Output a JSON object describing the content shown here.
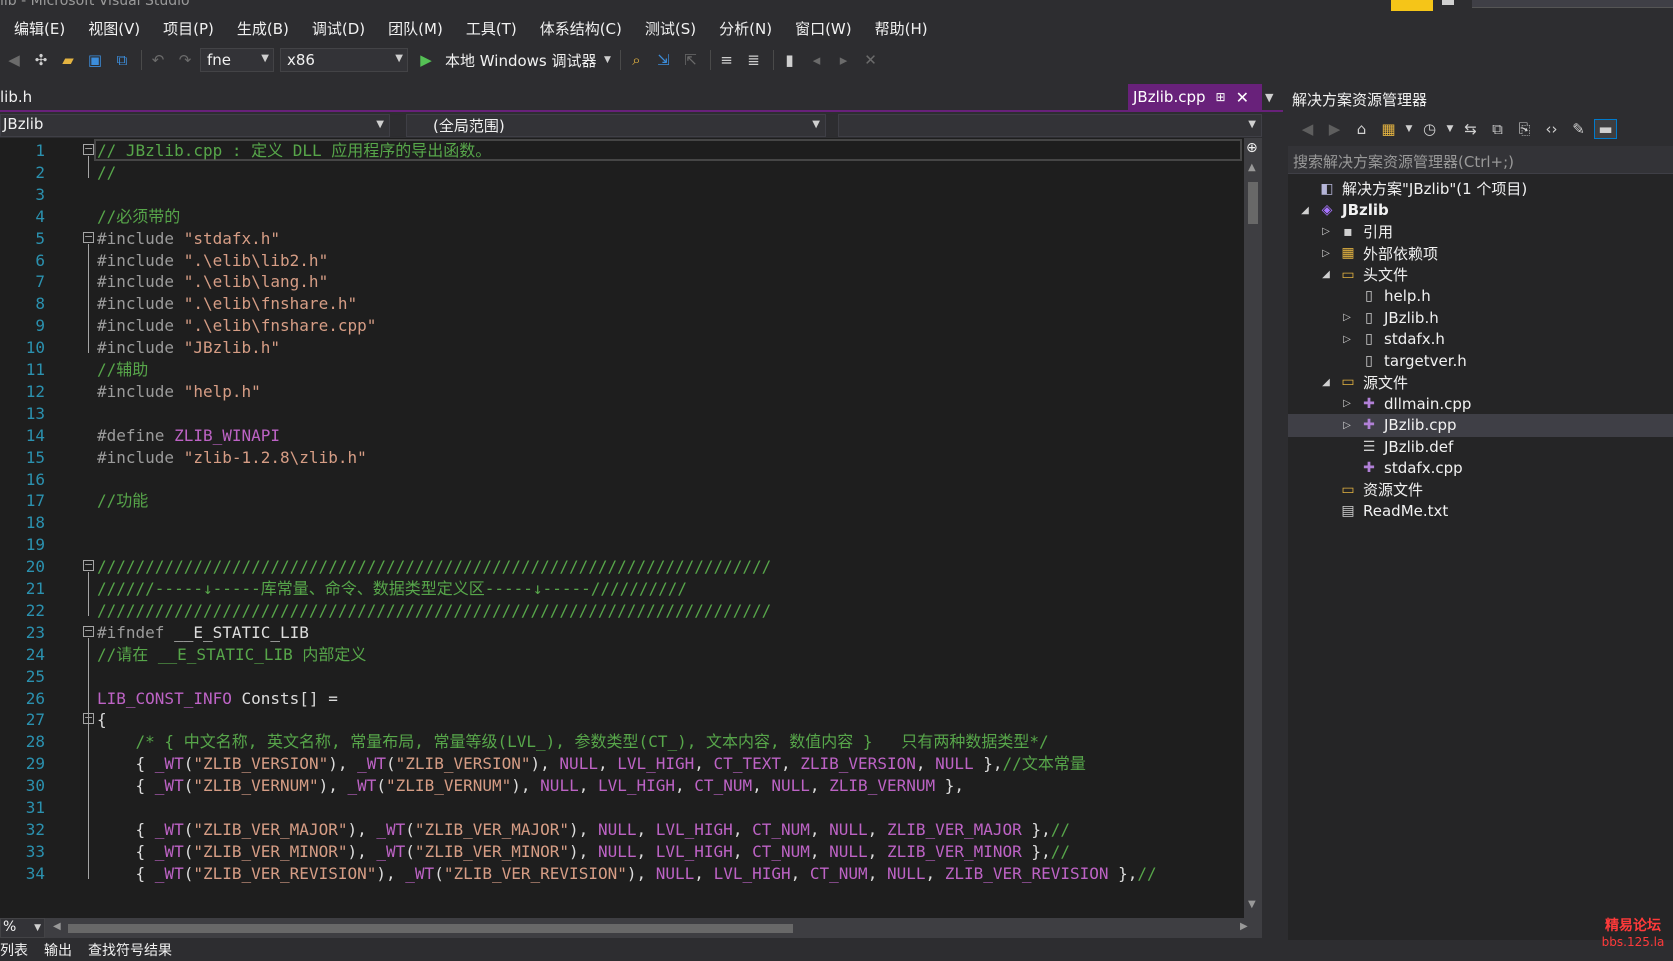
{
  "window": {
    "title": "lib - Microsoft Visual Studio"
  },
  "menu": [
    "编辑(E)",
    "视图(V)",
    "项目(P)",
    "生成(B)",
    "调试(D)",
    "团队(M)",
    "工具(T)",
    "体系结构(C)",
    "测试(S)",
    "分析(N)",
    "窗口(W)",
    "帮助(H)"
  ],
  "toolbar": {
    "config": "fne",
    "platform": "x86",
    "run_label": "本地 Windows 调试器",
    "icons": [
      "back-icon",
      "new-project-icon",
      "open-icon",
      "save-icon",
      "save-all-icon",
      "undo-icon",
      "redo-icon",
      "run-icon",
      "find-icon",
      "step-icon",
      "comment-icon",
      "bookmark-icon"
    ]
  },
  "tabs": {
    "left_tab": "lib.h",
    "active_tab": "JBzlib.cpp"
  },
  "navbar": {
    "project": "JBzlib",
    "scope": "(全局范围)",
    "member": ""
  },
  "editor": {
    "lines": [
      {
        "n": "1",
        "segs": [
          [
            "c-cmt",
            "// JBzlib.cpp : 定义 DLL 应用程序的导出函数。"
          ]
        ]
      },
      {
        "n": "2",
        "segs": [
          [
            "c-cmt",
            "//"
          ]
        ]
      },
      {
        "n": "3",
        "segs": []
      },
      {
        "n": "4",
        "segs": [
          [
            "c-cmt",
            "//必须带的"
          ]
        ]
      },
      {
        "n": "5",
        "segs": [
          [
            "c-pp",
            "#include "
          ],
          [
            "c-str",
            "\"stdafx.h\""
          ]
        ]
      },
      {
        "n": "6",
        "segs": [
          [
            "c-pp",
            "#include "
          ],
          [
            "c-str",
            "\".\\elib\\lib2.h\""
          ]
        ]
      },
      {
        "n": "7",
        "segs": [
          [
            "c-pp",
            "#include "
          ],
          [
            "c-str",
            "\".\\elib\\lang.h\""
          ]
        ]
      },
      {
        "n": "8",
        "segs": [
          [
            "c-pp",
            "#include "
          ],
          [
            "c-str",
            "\".\\elib\\fnshare.h\""
          ]
        ]
      },
      {
        "n": "9",
        "segs": [
          [
            "c-pp",
            "#include "
          ],
          [
            "c-str",
            "\".\\elib\\fnshare.cpp\""
          ]
        ]
      },
      {
        "n": "10",
        "segs": [
          [
            "c-pp",
            "#include "
          ],
          [
            "c-str",
            "\"JBzlib.h\""
          ]
        ]
      },
      {
        "n": "11",
        "segs": [
          [
            "c-cmt",
            "//辅助"
          ]
        ]
      },
      {
        "n": "12",
        "segs": [
          [
            "c-pp",
            "#include "
          ],
          [
            "c-str",
            "\"help.h\""
          ]
        ]
      },
      {
        "n": "13",
        "segs": []
      },
      {
        "n": "14",
        "segs": [
          [
            "c-pp",
            "#define "
          ],
          [
            "c-mac",
            "ZLIB_WINAPI"
          ]
        ]
      },
      {
        "n": "15",
        "segs": [
          [
            "c-pp",
            "#include "
          ],
          [
            "c-str",
            "\"zlib-1.2.8\\zlib.h\""
          ]
        ]
      },
      {
        "n": "16",
        "segs": []
      },
      {
        "n": "17",
        "segs": [
          [
            "c-cmt",
            "//功能"
          ]
        ]
      },
      {
        "n": "18",
        "segs": []
      },
      {
        "n": "19",
        "segs": []
      },
      {
        "n": "20",
        "segs": [
          [
            "c-cmt",
            "//////////////////////////////////////////////////////////////////////"
          ]
        ]
      },
      {
        "n": "21",
        "segs": [
          [
            "c-cmt",
            "//////-----↓-----库常量、命令、数据类型定义区-----↓-----//////////"
          ]
        ]
      },
      {
        "n": "22",
        "segs": [
          [
            "c-cmt",
            "//////////////////////////////////////////////////////////////////////"
          ]
        ]
      },
      {
        "n": "23",
        "segs": [
          [
            "c-pp",
            "#ifndef "
          ],
          [
            "c-id",
            "__E_STATIC_LIB"
          ]
        ]
      },
      {
        "n": "24",
        "segs": [
          [
            "c-cmt",
            "//请在 __E_STATIC_LIB 内部定义"
          ]
        ]
      },
      {
        "n": "25",
        "segs": []
      },
      {
        "n": "26",
        "segs": [
          [
            "c-mac",
            "LIB_CONST_INFO"
          ],
          [
            "c-id",
            " Consts[] ="
          ]
        ]
      },
      {
        "n": "27",
        "segs": [
          [
            "c-id",
            "{"
          ]
        ]
      },
      {
        "n": "28",
        "segs": [
          [
            "c-id",
            "    "
          ],
          [
            "c-cmt",
            "/* { 中文名称, 英文名称, 常量布局, 常量等级(LVL_), 参数类型(CT_), 文本内容, 数值内容 }   只有两种数据类型*/"
          ]
        ]
      },
      {
        "n": "29",
        "segs": [
          [
            "c-id",
            "    { "
          ],
          [
            "c-mac",
            "_WT"
          ],
          [
            "c-id",
            "("
          ],
          [
            "c-str",
            "\"ZLIB_VERSION\""
          ],
          [
            "c-id",
            "), "
          ],
          [
            "c-mac",
            "_WT"
          ],
          [
            "c-id",
            "("
          ],
          [
            "c-str",
            "\"ZLIB_VERSION\""
          ],
          [
            "c-id",
            "), "
          ],
          [
            "c-mac",
            "NULL"
          ],
          [
            "c-id",
            ", "
          ],
          [
            "c-mac",
            "LVL_HIGH"
          ],
          [
            "c-id",
            ", "
          ],
          [
            "c-mac",
            "CT_TEXT"
          ],
          [
            "c-id",
            ", "
          ],
          [
            "c-mac",
            "ZLIB_VERSION"
          ],
          [
            "c-id",
            ", "
          ],
          [
            "c-mac",
            "NULL"
          ],
          [
            "c-id",
            " },"
          ],
          [
            "c-cmt",
            "//文本常量"
          ]
        ]
      },
      {
        "n": "30",
        "segs": [
          [
            "c-id",
            "    { "
          ],
          [
            "c-mac",
            "_WT"
          ],
          [
            "c-id",
            "("
          ],
          [
            "c-str",
            "\"ZLIB_VERNUM\""
          ],
          [
            "c-id",
            "), "
          ],
          [
            "c-mac",
            "_WT"
          ],
          [
            "c-id",
            "("
          ],
          [
            "c-str",
            "\"ZLIB_VERNUM\""
          ],
          [
            "c-id",
            "), "
          ],
          [
            "c-mac",
            "NULL"
          ],
          [
            "c-id",
            ", "
          ],
          [
            "c-mac",
            "LVL_HIGH"
          ],
          [
            "c-id",
            ", "
          ],
          [
            "c-mac",
            "CT_NUM"
          ],
          [
            "c-id",
            ", "
          ],
          [
            "c-mac",
            "NULL"
          ],
          [
            "c-id",
            ", "
          ],
          [
            "c-mac",
            "ZLIB_VERNUM"
          ],
          [
            "c-id",
            " },"
          ]
        ]
      },
      {
        "n": "31",
        "segs": []
      },
      {
        "n": "32",
        "segs": [
          [
            "c-id",
            "    { "
          ],
          [
            "c-mac",
            "_WT"
          ],
          [
            "c-id",
            "("
          ],
          [
            "c-str",
            "\"ZLIB_VER_MAJOR\""
          ],
          [
            "c-id",
            "), "
          ],
          [
            "c-mac",
            "_WT"
          ],
          [
            "c-id",
            "("
          ],
          [
            "c-str",
            "\"ZLIB_VER_MAJOR\""
          ],
          [
            "c-id",
            "), "
          ],
          [
            "c-mac",
            "NULL"
          ],
          [
            "c-id",
            ", "
          ],
          [
            "c-mac",
            "LVL_HIGH"
          ],
          [
            "c-id",
            ", "
          ],
          [
            "c-mac",
            "CT_NUM"
          ],
          [
            "c-id",
            ", "
          ],
          [
            "c-mac",
            "NULL"
          ],
          [
            "c-id",
            ", "
          ],
          [
            "c-mac",
            "ZLIB_VER_MAJOR"
          ],
          [
            "c-id",
            " },"
          ],
          [
            "c-cmt",
            "//"
          ]
        ]
      },
      {
        "n": "33",
        "segs": [
          [
            "c-id",
            "    { "
          ],
          [
            "c-mac",
            "_WT"
          ],
          [
            "c-id",
            "("
          ],
          [
            "c-str",
            "\"ZLIB_VER_MINOR\""
          ],
          [
            "c-id",
            "), "
          ],
          [
            "c-mac",
            "_WT"
          ],
          [
            "c-id",
            "("
          ],
          [
            "c-str",
            "\"ZLIB_VER_MINOR\""
          ],
          [
            "c-id",
            "), "
          ],
          [
            "c-mac",
            "NULL"
          ],
          [
            "c-id",
            ", "
          ],
          [
            "c-mac",
            "LVL_HIGH"
          ],
          [
            "c-id",
            ", "
          ],
          [
            "c-mac",
            "CT_NUM"
          ],
          [
            "c-id",
            ", "
          ],
          [
            "c-mac",
            "NULL"
          ],
          [
            "c-id",
            ", "
          ],
          [
            "c-mac",
            "ZLIB_VER_MINOR"
          ],
          [
            "c-id",
            " },"
          ],
          [
            "c-cmt",
            "//"
          ]
        ]
      },
      {
        "n": "34",
        "segs": [
          [
            "c-id",
            "    { "
          ],
          [
            "c-mac",
            "_WT"
          ],
          [
            "c-id",
            "("
          ],
          [
            "c-str",
            "\"ZLIB_VER_REVISION\""
          ],
          [
            "c-id",
            "), "
          ],
          [
            "c-mac",
            "_WT"
          ],
          [
            "c-id",
            "("
          ],
          [
            "c-str",
            "\"ZLIB_VER_REVISION\""
          ],
          [
            "c-id",
            "), "
          ],
          [
            "c-mac",
            "NULL"
          ],
          [
            "c-id",
            ", "
          ],
          [
            "c-mac",
            "LVL_HIGH"
          ],
          [
            "c-id",
            ", "
          ],
          [
            "c-mac",
            "CT_NUM"
          ],
          [
            "c-id",
            ", "
          ],
          [
            "c-mac",
            "NULL"
          ],
          [
            "c-id",
            ", "
          ],
          [
            "c-mac",
            "ZLIB_VER_REVISION"
          ],
          [
            "c-id",
            " },"
          ],
          [
            "c-cmt",
            "//"
          ]
        ]
      }
    ],
    "fold_lines": [
      "1",
      "5",
      "20",
      "23",
      "27"
    ]
  },
  "zoom": "%",
  "bottom_tabs": [
    "列表",
    "输出",
    "查找符号结果"
  ],
  "solution_explorer": {
    "title": "解决方案资源管理器",
    "search_placeholder": "搜索解决方案资源管理器(Ctrl+;)",
    "tree": [
      {
        "label": "解决方案\"JBzlib\"(1 个项目)",
        "level": 0,
        "exp": "",
        "icon": "solution-icon",
        "cls": "ico-sln",
        "glyph": "◧"
      },
      {
        "label": "JBzlib",
        "level": 0,
        "exp": "◢",
        "icon": "project-icon",
        "cls": "ico-proj",
        "glyph": "◈",
        "bold": true
      },
      {
        "label": "引用",
        "level": 1,
        "exp": "▷",
        "icon": "references-icon",
        "cls": "ico-ref",
        "glyph": "▪"
      },
      {
        "label": "外部依赖项",
        "level": 1,
        "exp": "▷",
        "icon": "external-deps-icon",
        "cls": "ico-folder",
        "glyph": "▦"
      },
      {
        "label": "头文件",
        "level": 1,
        "exp": "◢",
        "icon": "folder-icon",
        "cls": "ico-folder",
        "glyph": "▭"
      },
      {
        "label": "help.h",
        "level": 2,
        "exp": "",
        "icon": "header-file-icon",
        "cls": "ico-h",
        "glyph": "▯"
      },
      {
        "label": "JBzlib.h",
        "level": 2,
        "exp": "▷",
        "icon": "header-file-icon",
        "cls": "ico-h",
        "glyph": "▯"
      },
      {
        "label": "stdafx.h",
        "level": 2,
        "exp": "▷",
        "icon": "header-file-icon",
        "cls": "ico-h",
        "glyph": "▯"
      },
      {
        "label": "targetver.h",
        "level": 2,
        "exp": "",
        "icon": "header-file-icon",
        "cls": "ico-h",
        "glyph": "▯"
      },
      {
        "label": "源文件",
        "level": 1,
        "exp": "◢",
        "icon": "folder-icon",
        "cls": "ico-folder",
        "glyph": "▭"
      },
      {
        "label": "dllmain.cpp",
        "level": 2,
        "exp": "▷",
        "icon": "cpp-file-icon",
        "cls": "ico-cpp",
        "glyph": "✚"
      },
      {
        "label": "JBzlib.cpp",
        "level": 2,
        "exp": "▷",
        "icon": "cpp-file-icon",
        "cls": "ico-cpp",
        "glyph": "✚",
        "selected": true
      },
      {
        "label": "JBzlib.def",
        "level": 2,
        "exp": "",
        "icon": "def-file-icon",
        "cls": "ico-def",
        "glyph": "☰"
      },
      {
        "label": "stdafx.cpp",
        "level": 2,
        "exp": "",
        "icon": "cpp-file-icon",
        "cls": "ico-cpp",
        "glyph": "✚"
      },
      {
        "label": "资源文件",
        "level": 1,
        "exp": "",
        "icon": "folder-icon",
        "cls": "ico-folder",
        "glyph": "▭"
      },
      {
        "label": "ReadMe.txt",
        "level": 1,
        "exp": "",
        "icon": "text-file-icon",
        "cls": "ico-txt",
        "glyph": "▤"
      }
    ]
  },
  "watermark": {
    "line1": "精易论坛",
    "line2": "bbs.125.la"
  },
  "colors": {
    "accent": "#68217a",
    "comment": "#57a64a",
    "string": "#d69d85",
    "macro": "#bd63c5",
    "line_number": "#2b91af"
  }
}
